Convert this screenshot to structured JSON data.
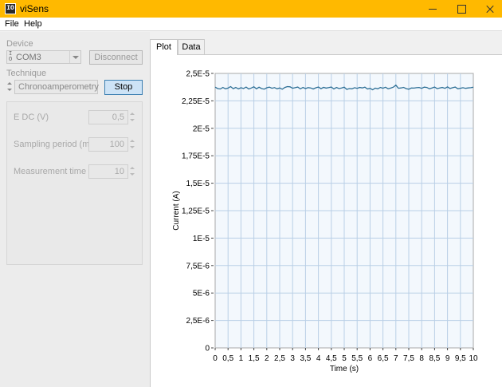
{
  "window": {
    "title": "viSens",
    "icon": "visens-app-icon",
    "titlebar_color": "#ffb900"
  },
  "menu": {
    "file": "File",
    "help": "Help"
  },
  "device": {
    "label": "Device",
    "selected": "COM3",
    "io_icon_text": "I/O",
    "disconnect_label": "Disconnect"
  },
  "technique": {
    "label": "Technique",
    "selected": "Chronoamperometry",
    "stop_label": "Stop"
  },
  "params": {
    "edc_label": "E DC (V)",
    "edc_value": "0,5",
    "sampling_label": "Sampling period (ms)",
    "sampling_value": "100",
    "measure_label": "Measurement time (s)",
    "measure_value": "10"
  },
  "tabs": {
    "plot": "Plot",
    "data": "Data"
  },
  "chart_data": {
    "type": "line",
    "xlabel": "Time (s)",
    "ylabel": "Current (A)",
    "xlim": [
      0,
      10
    ],
    "ylim": [
      0,
      2.5e-05
    ],
    "x_ticks": [
      "0",
      "0,5",
      "1",
      "1,5",
      "2",
      "2,5",
      "3",
      "3,5",
      "4",
      "4,5",
      "5",
      "5,5",
      "6",
      "6,5",
      "7",
      "7,5",
      "8",
      "8,5",
      "9",
      "9,5",
      "10"
    ],
    "y_ticks": [
      "0",
      "2,5E-6",
      "5E-6",
      "7,5E-6",
      "1E-5",
      "1,25E-5",
      "1,5E-5",
      "1,75E-5",
      "2E-5",
      "2,25E-5",
      "2,5E-5"
    ],
    "grid": true,
    "line_color": "#2d6f96",
    "series": [
      {
        "x": [
          0,
          0.1,
          0.2,
          0.3,
          0.4,
          0.5,
          0.6,
          0.7,
          0.8,
          0.9,
          1.0,
          1.1,
          1.2,
          1.3,
          1.4,
          1.5,
          1.6,
          1.7,
          1.8,
          1.9,
          2.0,
          2.1,
          2.2,
          2.3,
          2.4,
          2.5,
          2.6,
          2.7,
          2.8,
          2.9,
          3.0,
          3.1,
          3.2,
          3.3,
          3.4,
          3.5,
          3.6,
          3.7,
          3.8,
          3.9,
          4.0,
          4.1,
          4.2,
          4.3,
          4.4,
          4.5,
          4.6,
          4.7,
          4.8,
          4.9,
          5.0,
          5.1,
          5.2,
          5.3,
          5.4,
          5.5,
          5.6,
          5.7,
          5.8,
          5.9,
          6.0,
          6.1,
          6.2,
          6.3,
          6.4,
          6.5,
          6.6,
          6.7,
          6.8,
          6.9,
          7.0,
          7.1,
          7.2,
          7.3,
          7.4,
          7.5,
          7.6,
          7.7,
          7.8,
          7.9,
          8.0,
          8.1,
          8.2,
          8.3,
          8.4,
          8.5,
          8.6,
          8.7,
          8.8,
          8.9,
          9.0,
          9.1,
          9.2,
          9.3,
          9.4,
          9.5,
          9.6,
          9.7,
          9.8,
          9.9,
          10.0
        ],
        "y": [
          2.375e-05,
          2.362e-05,
          2.358e-05,
          2.372e-05,
          2.36e-05,
          2.366e-05,
          2.38e-05,
          2.361e-05,
          2.372e-05,
          2.359e-05,
          2.37e-05,
          2.363e-05,
          2.376e-05,
          2.358e-05,
          2.367e-05,
          2.378e-05,
          2.36e-05,
          2.374e-05,
          2.362e-05,
          2.357e-05,
          2.369e-05,
          2.375e-05,
          2.365e-05,
          2.371e-05,
          2.36e-05,
          2.368e-05,
          2.356e-05,
          2.372e-05,
          2.38e-05,
          2.378e-05,
          2.365e-05,
          2.37e-05,
          2.376e-05,
          2.359e-05,
          2.372e-05,
          2.362e-05,
          2.371e-05,
          2.368e-05,
          2.358e-05,
          2.369e-05,
          2.376e-05,
          2.361e-05,
          2.373e-05,
          2.366e-05,
          2.371e-05,
          2.376e-05,
          2.358e-05,
          2.372e-05,
          2.362e-05,
          2.368e-05,
          2.375e-05,
          2.355e-05,
          2.362e-05,
          2.36e-05,
          2.37e-05,
          2.364e-05,
          2.372e-05,
          2.368e-05,
          2.375e-05,
          2.358e-05,
          2.364e-05,
          2.351e-05,
          2.366e-05,
          2.36e-05,
          2.372e-05,
          2.365e-05,
          2.374e-05,
          2.36e-05,
          2.366e-05,
          2.375e-05,
          2.393e-05,
          2.365e-05,
          2.368e-05,
          2.373e-05,
          2.361e-05,
          2.356e-05,
          2.367e-05,
          2.366e-05,
          2.37e-05,
          2.372e-05,
          2.364e-05,
          2.375e-05,
          2.372e-05,
          2.36e-05,
          2.368e-05,
          2.376e-05,
          2.361e-05,
          2.368e-05,
          2.372e-05,
          2.364e-05,
          2.377e-05,
          2.363e-05,
          2.37e-05,
          2.376e-05,
          2.36e-05,
          2.365e-05,
          2.37e-05,
          2.364e-05,
          2.368e-05,
          2.37e-05,
          2.374e-05
        ]
      }
    ]
  }
}
